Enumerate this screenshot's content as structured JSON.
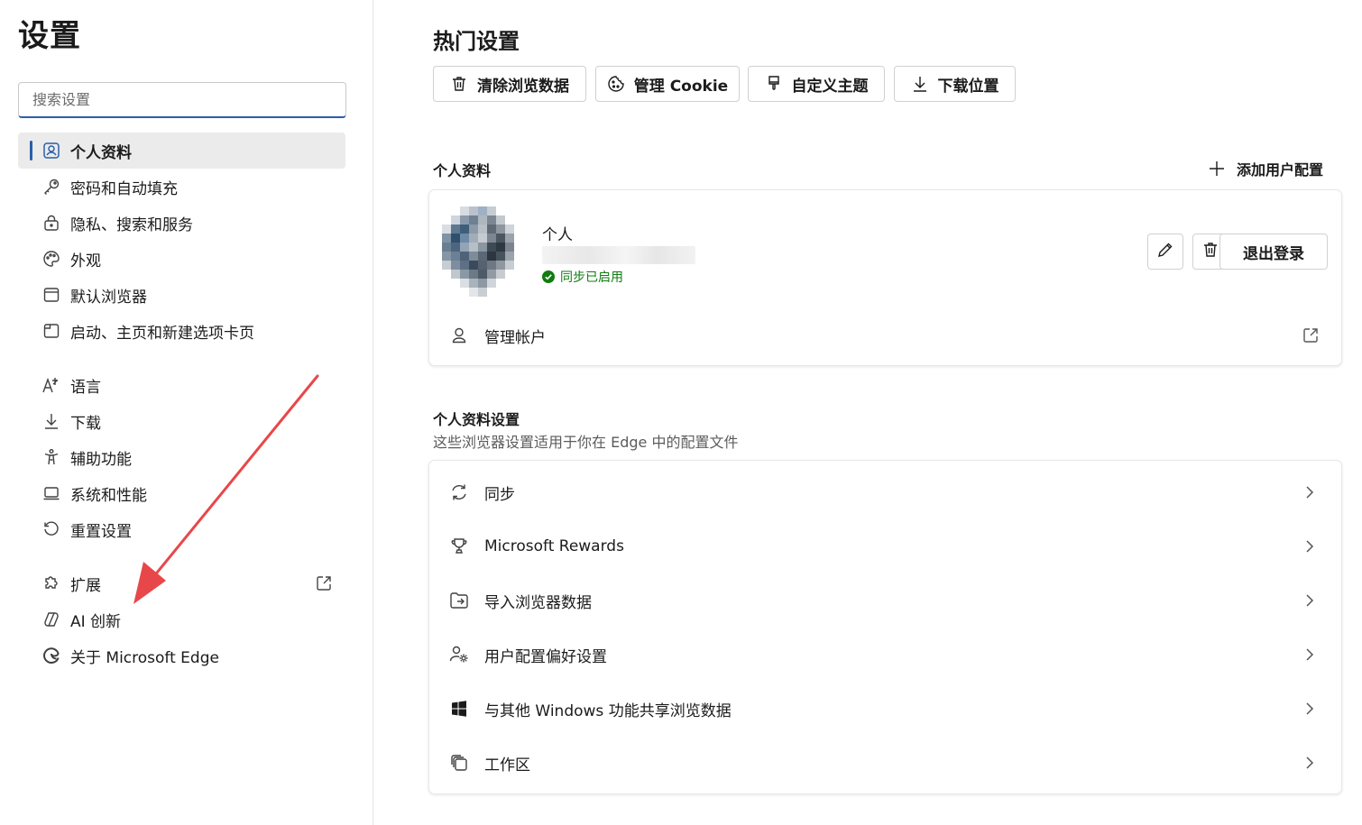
{
  "sidebar": {
    "title": "设置",
    "search_placeholder": "搜索设置",
    "items": [
      {
        "label": "个人资料",
        "icon": "profile-icon"
      },
      {
        "label": "密码和自动填充",
        "icon": "key-icon"
      },
      {
        "label": "隐私、搜索和服务",
        "icon": "lock-icon"
      },
      {
        "label": "外观",
        "icon": "palette-icon"
      },
      {
        "label": "默认浏览器",
        "icon": "browser-icon"
      },
      {
        "label": "启动、主页和新建选项卡页",
        "icon": "home-tab-icon"
      },
      {
        "label": "语言",
        "icon": "language-icon"
      },
      {
        "label": "下载",
        "icon": "download-icon"
      },
      {
        "label": "辅助功能",
        "icon": "accessibility-icon"
      },
      {
        "label": "系统和性能",
        "icon": "laptop-icon"
      },
      {
        "label": "重置设置",
        "icon": "reset-icon"
      },
      {
        "label": "扩展",
        "icon": "puzzle-icon"
      },
      {
        "label": "AI 创新",
        "icon": "ai-icon"
      },
      {
        "label": "关于 Microsoft Edge",
        "icon": "edge-icon"
      }
    ]
  },
  "main": {
    "hot_title": "热门设置",
    "quick_actions": [
      {
        "label": "清除浏览数据",
        "icon": "trash-icon"
      },
      {
        "label": "管理 Cookie",
        "icon": "cookie-icon"
      },
      {
        "label": "自定义主题",
        "icon": "brush-icon"
      },
      {
        "label": "下载位置",
        "icon": "download-icon"
      }
    ],
    "profile_section_title": "个人资料",
    "add_profile_label": "添加用户配置",
    "profile": {
      "name": "个人",
      "sync_status": "同步已启用",
      "signout_label": "退出登录",
      "manage_account_label": "管理帐户"
    },
    "profile_settings_title": "个人资料设置",
    "profile_settings_desc": "这些浏览器设置适用于你在 Edge 中的配置文件",
    "settings_rows": [
      {
        "label": "同步",
        "icon": "sync-icon"
      },
      {
        "label": "Microsoft Rewards",
        "icon": "trophy-icon"
      },
      {
        "label": "导入浏览器数据",
        "icon": "import-icon"
      },
      {
        "label": "用户配置偏好设置",
        "icon": "user-settings-icon"
      },
      {
        "label": "与其他 Windows 功能共享浏览数据",
        "icon": "windows-icon"
      },
      {
        "label": "工作区",
        "icon": "workspace-icon"
      }
    ]
  },
  "colors": {
    "accent": "#2a5fa8",
    "sync_green": "#107c10",
    "annotation_red": "#e8474a"
  }
}
